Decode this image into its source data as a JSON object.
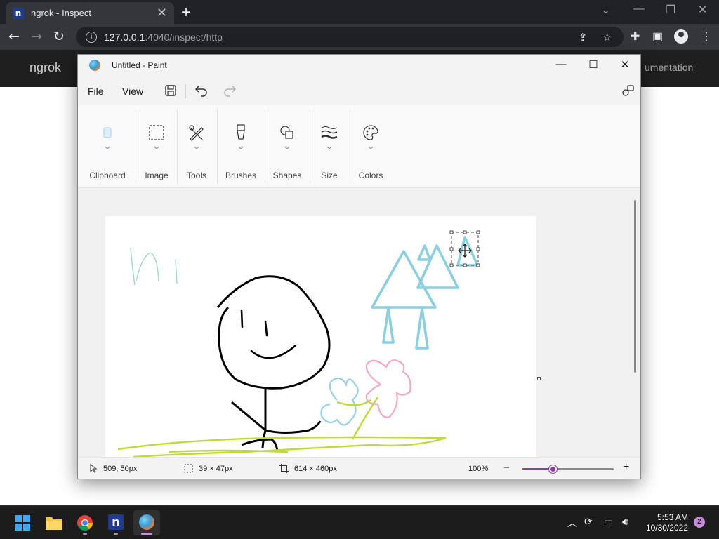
{
  "browser": {
    "tab_title": "ngrok - Inspect",
    "tab_favicon": "n",
    "url_host": "127.0.0.1",
    "url_rest": ":4040/inspect/http"
  },
  "webpage": {
    "brand": "ngrok",
    "docs_link": "umentation"
  },
  "paint": {
    "window_title": "Untitled - Paint",
    "menu": {
      "file": "File",
      "view": "View"
    },
    "ribbon_groups": [
      "Clipboard",
      "Image",
      "Tools",
      "Brushes",
      "Shapes",
      "Size",
      "Colors"
    ],
    "status": {
      "cursor_pos": "509, 50px",
      "selection_size": "39 × 47px",
      "canvas_size": "614 × 460px",
      "zoom": "100%",
      "zoom_level": 0.33
    },
    "accent_color": "#8e3ea8"
  },
  "taskbar": {
    "time": "5:53 AM",
    "date": "10/30/2022",
    "notification_count": "2"
  }
}
